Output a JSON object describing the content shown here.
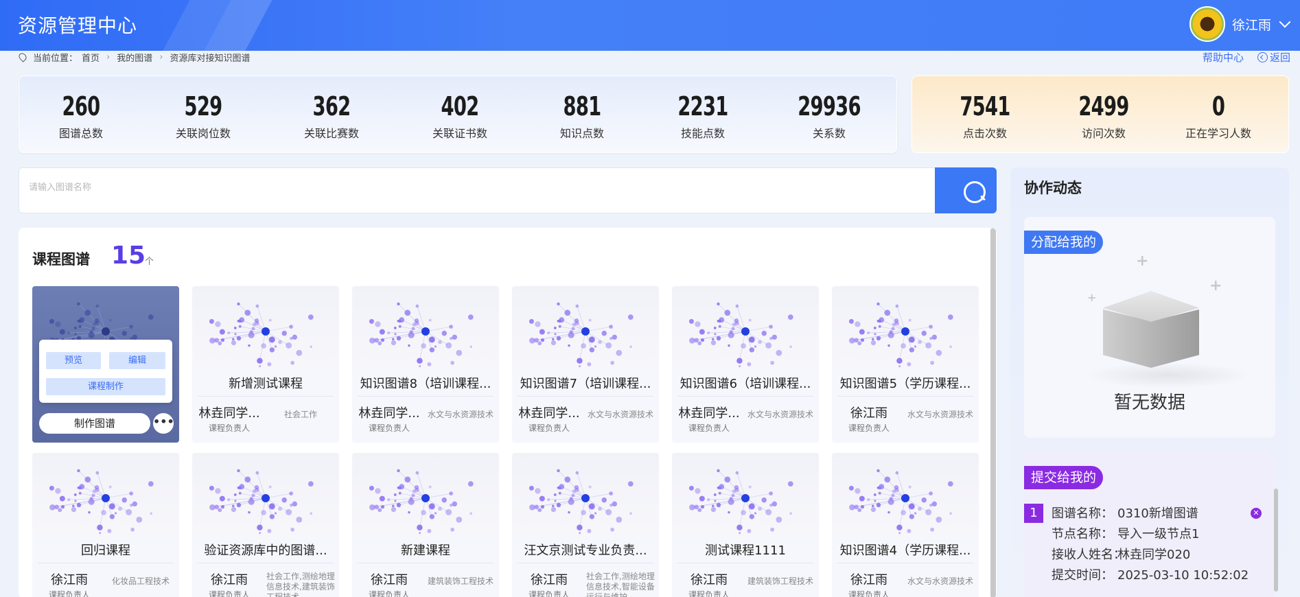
{
  "header": {
    "title": "资源管理中心",
    "user_name": "徐江雨"
  },
  "breadcrumb": {
    "prefix": "当前位置：",
    "items": [
      "首页",
      "我的图谱",
      "资源库对接知识图谱"
    ]
  },
  "top_links": {
    "help": "帮助中心",
    "back": "返回"
  },
  "stats_left": [
    {
      "value": "260",
      "label": "图谱总数"
    },
    {
      "value": "529",
      "label": "关联岗位数"
    },
    {
      "value": "362",
      "label": "关联比赛数"
    },
    {
      "value": "402",
      "label": "关联证书数"
    },
    {
      "value": "881",
      "label": "知识点数"
    },
    {
      "value": "2231",
      "label": "技能点数"
    },
    {
      "value": "29936",
      "label": "关系数"
    }
  ],
  "stats_right": [
    {
      "value": "7541",
      "label": "点击次数"
    },
    {
      "value": "2499",
      "label": "访问次数"
    },
    {
      "value": "0",
      "label": "正在学习人数"
    }
  ],
  "search": {
    "placeholder": "请输入图谱名称"
  },
  "section": {
    "title": "课程图谱",
    "count": "15",
    "unit": "个"
  },
  "active_card": {
    "preview": "预览",
    "edit": "编辑",
    "course_make": "课程制作",
    "make": "制作图谱",
    "more": "•••"
  },
  "cards": [
    {
      "title": "",
      "owner": "",
      "role": "",
      "major": ""
    },
    {
      "title": "新增测试课程",
      "owner": "林垚同学...",
      "role": "课程负责人",
      "major": "社会工作"
    },
    {
      "title": "知识图谱8（培训课程...",
      "owner": "林垚同学...",
      "role": "课程负责人",
      "major": "水文与水资源技术"
    },
    {
      "title": "知识图谱7（培训课程...",
      "owner": "林垚同学...",
      "role": "课程负责人",
      "major": "水文与水资源技术"
    },
    {
      "title": "知识图谱6（培训课程...",
      "owner": "林垚同学...",
      "role": "课程负责人",
      "major": "水文与水资源技术"
    },
    {
      "title": "知识图谱5（学历课程...",
      "owner": "徐江雨",
      "role": "课程负责人",
      "major": "水文与水资源技术"
    },
    {
      "title": "回归课程",
      "owner": "徐江雨",
      "role": "课程负责人",
      "major": "化妆品工程技术"
    },
    {
      "title": "验证资源库中的图谱...",
      "owner": "徐江雨",
      "role": "课程负责人",
      "major": "社会工作,测绘地理信息技术,建筑装饰工程技术"
    },
    {
      "title": "新建课程",
      "owner": "徐江雨",
      "role": "课程负责人",
      "major": "建筑装饰工程技术"
    },
    {
      "title": "汪文京测试专业负责...",
      "owner": "徐江雨",
      "role": "课程负责人",
      "major": "社会工作,测绘地理信息技术,智能设备运行与维护"
    },
    {
      "title": "测试课程1111",
      "owner": "徐江雨",
      "role": "课程负责人",
      "major": "建筑装饰工程技术"
    },
    {
      "title": "知识图谱4（学历课程...",
      "owner": "徐江雨",
      "role": "课程负责人",
      "major": "水文与水资源技术"
    }
  ],
  "collab": {
    "title": "协作动态",
    "assigned_tag": "分配给我的",
    "empty_text": "暂无数据",
    "submitted_tag": "提交给我的",
    "item": {
      "index": "1",
      "name_k": "图谱名称：",
      "name_v": "0310新增图谱",
      "node_k": "节点名称：",
      "node_v": "导入一级节点1",
      "recv_k": "接收人姓名：",
      "recv_v": "林垚同学020",
      "time_k": "提交时间：",
      "time_v": "2025-03-10 10:52:02"
    }
  },
  "colors": {
    "primary": "#3a78f6",
    "accent_purple": "#8a2be2",
    "count_purple": "#5a3de6"
  }
}
